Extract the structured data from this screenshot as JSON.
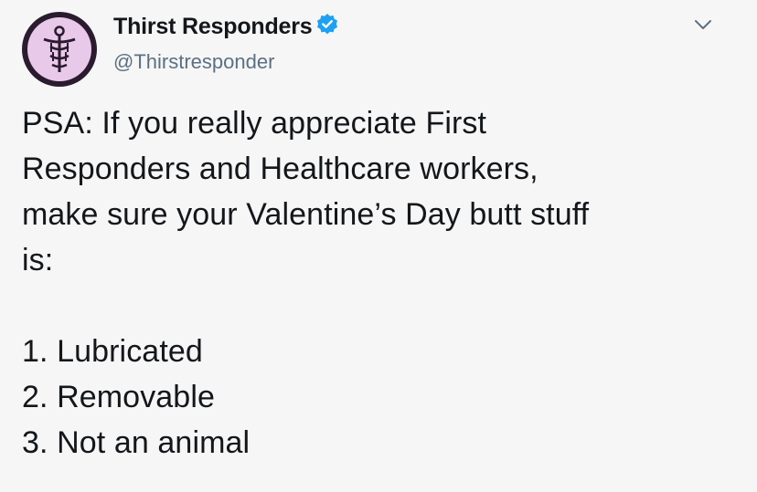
{
  "account": {
    "display_name": "Thirst Responders",
    "handle": "@Thirstresponder",
    "verified": true,
    "avatar_icon": "caduceus-icon",
    "menu_icon": "chevron-down-icon"
  },
  "tweet": {
    "lines": [
      "PSA: If you really appreciate First",
      "Responders and Healthcare workers,",
      "make sure your Valentine’s Day butt stuff",
      "is:"
    ],
    "list": [
      "1. Lubricated",
      "2. Removable",
      "3. Not an animal"
    ]
  },
  "colors": {
    "background": "#f6f6f6",
    "text": "#14171a",
    "handle": "#5b7083",
    "verified": "#1da1f2",
    "avatar_bg": "#e9c9ea",
    "avatar_ring": "#2a1b2e"
  }
}
